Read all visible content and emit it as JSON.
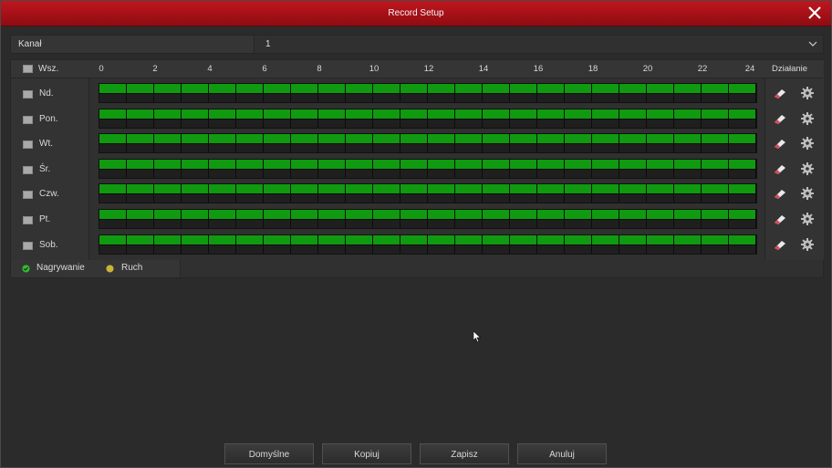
{
  "window": {
    "title": "Record Setup"
  },
  "channel": {
    "label": "Kanał",
    "value": "1"
  },
  "schedule": {
    "all_label": "Wsz.",
    "hours": [
      "0",
      "2",
      "4",
      "6",
      "8",
      "10",
      "12",
      "14",
      "16",
      "18",
      "20",
      "22",
      "24"
    ],
    "action_header": "Działanie",
    "days": [
      {
        "label": "Nd.",
        "recording_fraction": 1.0
      },
      {
        "label": "Pon.",
        "recording_fraction": 1.0
      },
      {
        "label": "Wt.",
        "recording_fraction": 1.0
      },
      {
        "label": "Śr.",
        "recording_fraction": 1.0
      },
      {
        "label": "Czw.",
        "recording_fraction": 1.0
      },
      {
        "label": "Pt.",
        "recording_fraction": 1.0
      },
      {
        "label": "Sob.",
        "recording_fraction": 1.0
      }
    ]
  },
  "legend": {
    "recording_label": "Nagrywanie",
    "recording_color": "#2fbf2f",
    "motion_label": "Ruch",
    "motion_color": "#c9b43a"
  },
  "buttons": {
    "default": "Domyślne",
    "copy": "Kopiuj",
    "save": "Zapisz",
    "cancel": "Anuluj"
  },
  "colors": {
    "titlebar": "#b0121a",
    "record_fill": "#109a10"
  }
}
